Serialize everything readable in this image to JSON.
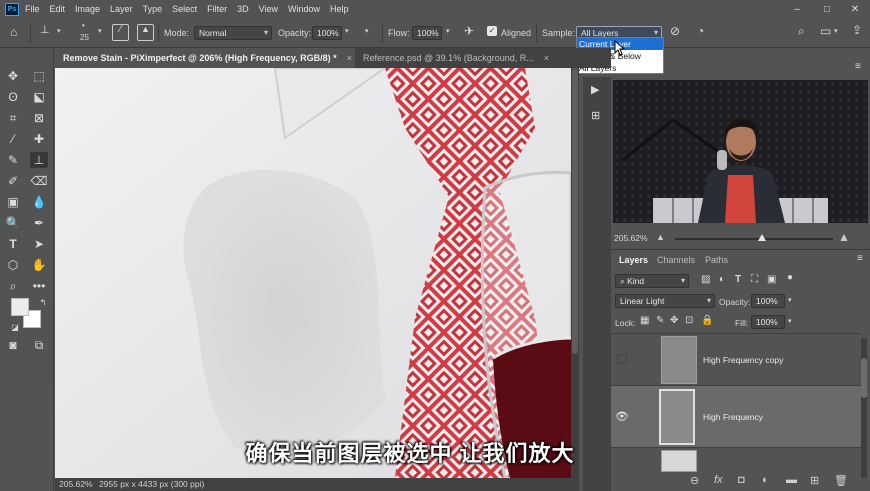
{
  "menubar": {
    "logo": "Ps",
    "items": [
      "File",
      "Edit",
      "Image",
      "Layer",
      "Type",
      "Select",
      "Filter",
      "3D",
      "View",
      "Window",
      "Help"
    ],
    "window_controls": [
      "–",
      "□",
      "✕"
    ]
  },
  "options": {
    "brush_size": "25",
    "mode_label": "Mode:",
    "mode_value": "Normal",
    "opacity_label": "Opacity:",
    "opacity_value": "100%",
    "flow_label": "Flow:",
    "flow_value": "100%",
    "aligned_label": "Aligned",
    "aligned_checked": true,
    "sample_label": "Sample:",
    "sample_value": "All Layers",
    "sample_options": [
      "Current Layer",
      "Current & Below",
      "All Layers"
    ],
    "sample_highlighted": "Current Layer"
  },
  "tabs": [
    {
      "label": "Remove Stain - PiXimperfect @ 206% (High Frequency, RGB/8) *",
      "close": "×",
      "active": true
    },
    {
      "label": "Reference.psd @ 39.1% (Background, R...",
      "close": "×",
      "active": false
    }
  ],
  "status": {
    "zoom": "205.62%",
    "doc_info": "2955 px x 4433 px (300 ppi)"
  },
  "subtitle": "确保当前图层被选中 让我们放大",
  "navigator": {
    "zoom": "205.62%"
  },
  "layers_panel": {
    "tabs": [
      "Layers",
      "Channels",
      "Paths"
    ],
    "filter_kind": "Kind",
    "blend_mode": "Linear Light",
    "opacity_label": "Opacity:",
    "opacity_value": "100%",
    "lock_label": "Lock:",
    "fill_label": "Fill:",
    "fill_value": "100%",
    "layers": [
      {
        "name": "High Frequency copy",
        "visible": false,
        "selected": false
      },
      {
        "name": "High Frequency",
        "visible": true,
        "selected": true
      },
      {
        "name": "",
        "visible": false,
        "selected": false
      }
    ]
  },
  "colors": {
    "ui_bg": "#535353",
    "panel_dark": "#424242",
    "highlight": "#1e6fd1",
    "tie_red": "#d23a44",
    "wine": "#5b0b14"
  }
}
